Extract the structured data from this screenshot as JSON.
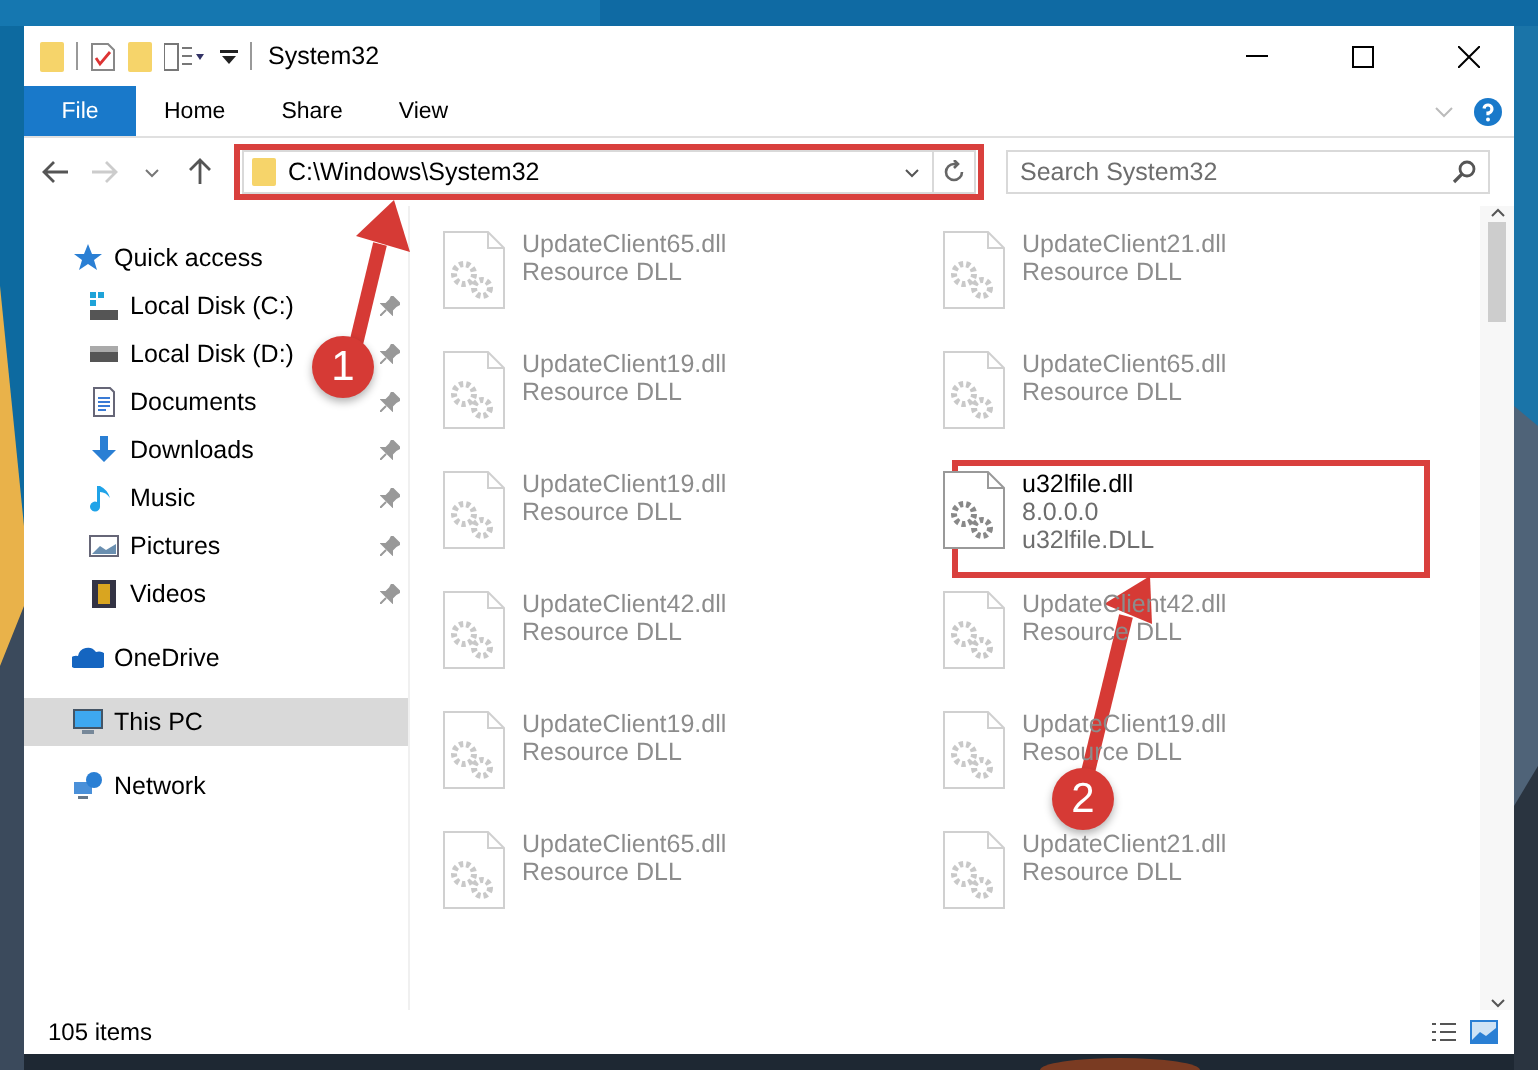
{
  "window": {
    "title": "System32"
  },
  "ribbon_tabs": [
    {
      "label": "File",
      "kind": "file"
    },
    {
      "label": "Home",
      "kind": "tab"
    },
    {
      "label": "Share",
      "kind": "tab"
    },
    {
      "label": "View",
      "kind": "tab"
    }
  ],
  "address": {
    "path": "C:\\Windows\\System32"
  },
  "search": {
    "placeholder": "Search System32"
  },
  "sidebar": [
    {
      "label": "Quick access",
      "kind": "star",
      "selected": false,
      "children": [
        {
          "label": "Local Disk (C:)",
          "kind": "drive-c",
          "pinned": true,
          "selected": false
        },
        {
          "label": "Local Disk (D:)",
          "kind": "drive",
          "pinned": true,
          "selected": false
        },
        {
          "label": "Documents",
          "kind": "documents",
          "pinned": true,
          "selected": false
        },
        {
          "label": "Downloads",
          "kind": "downloads",
          "pinned": true,
          "selected": false
        },
        {
          "label": "Music",
          "kind": "music",
          "pinned": true,
          "selected": false
        },
        {
          "label": "Pictures",
          "kind": "pictures",
          "pinned": true,
          "selected": false
        },
        {
          "label": "Videos",
          "kind": "videos",
          "pinned": true,
          "selected": false
        }
      ]
    },
    {
      "label": "OneDrive",
      "kind": "cloud",
      "selected": false
    },
    {
      "label": "This PC",
      "kind": "pc",
      "selected": true
    },
    {
      "label": "Network",
      "kind": "network",
      "selected": false
    }
  ],
  "files": [
    {
      "name": "UpdateClient65.dll",
      "lines": [
        "Resource DLL"
      ],
      "faded": true
    },
    {
      "name": "UpdateClient21.dll",
      "lines": [
        "Resource DLL"
      ],
      "faded": true
    },
    {
      "name": "UpdateClient19.dll",
      "lines": [
        "Resource DLL"
      ],
      "faded": true
    },
    {
      "name": "UpdateClient65.dll",
      "lines": [
        "Resource DLL"
      ],
      "faded": true
    },
    {
      "name": "UpdateClient19.dll",
      "lines": [
        "Resource DLL"
      ],
      "faded": true
    },
    {
      "name": "u32lfile.dll",
      "lines": [
        "8.0.0.0",
        "u32lfile.DLL"
      ],
      "faded": false
    },
    {
      "name": "UpdateClient42.dll",
      "lines": [
        "Resource DLL"
      ],
      "faded": true
    },
    {
      "name": "UpdateClient42.dll",
      "lines": [
        "Resource DLL"
      ],
      "faded": true
    },
    {
      "name": "UpdateClient19.dll",
      "lines": [
        "Resource DLL"
      ],
      "faded": true
    },
    {
      "name": "UpdateClient19.dll",
      "lines": [
        "Resource DLL"
      ],
      "faded": true
    },
    {
      "name": "UpdateClient65.dll",
      "lines": [
        "Resource DLL"
      ],
      "faded": true
    },
    {
      "name": "UpdateClient21.dll",
      "lines": [
        "Resource DLL"
      ],
      "faded": true
    }
  ],
  "annotations": [
    {
      "label": "1"
    },
    {
      "label": "2"
    }
  ],
  "status_bar": {
    "count": "105 items"
  }
}
